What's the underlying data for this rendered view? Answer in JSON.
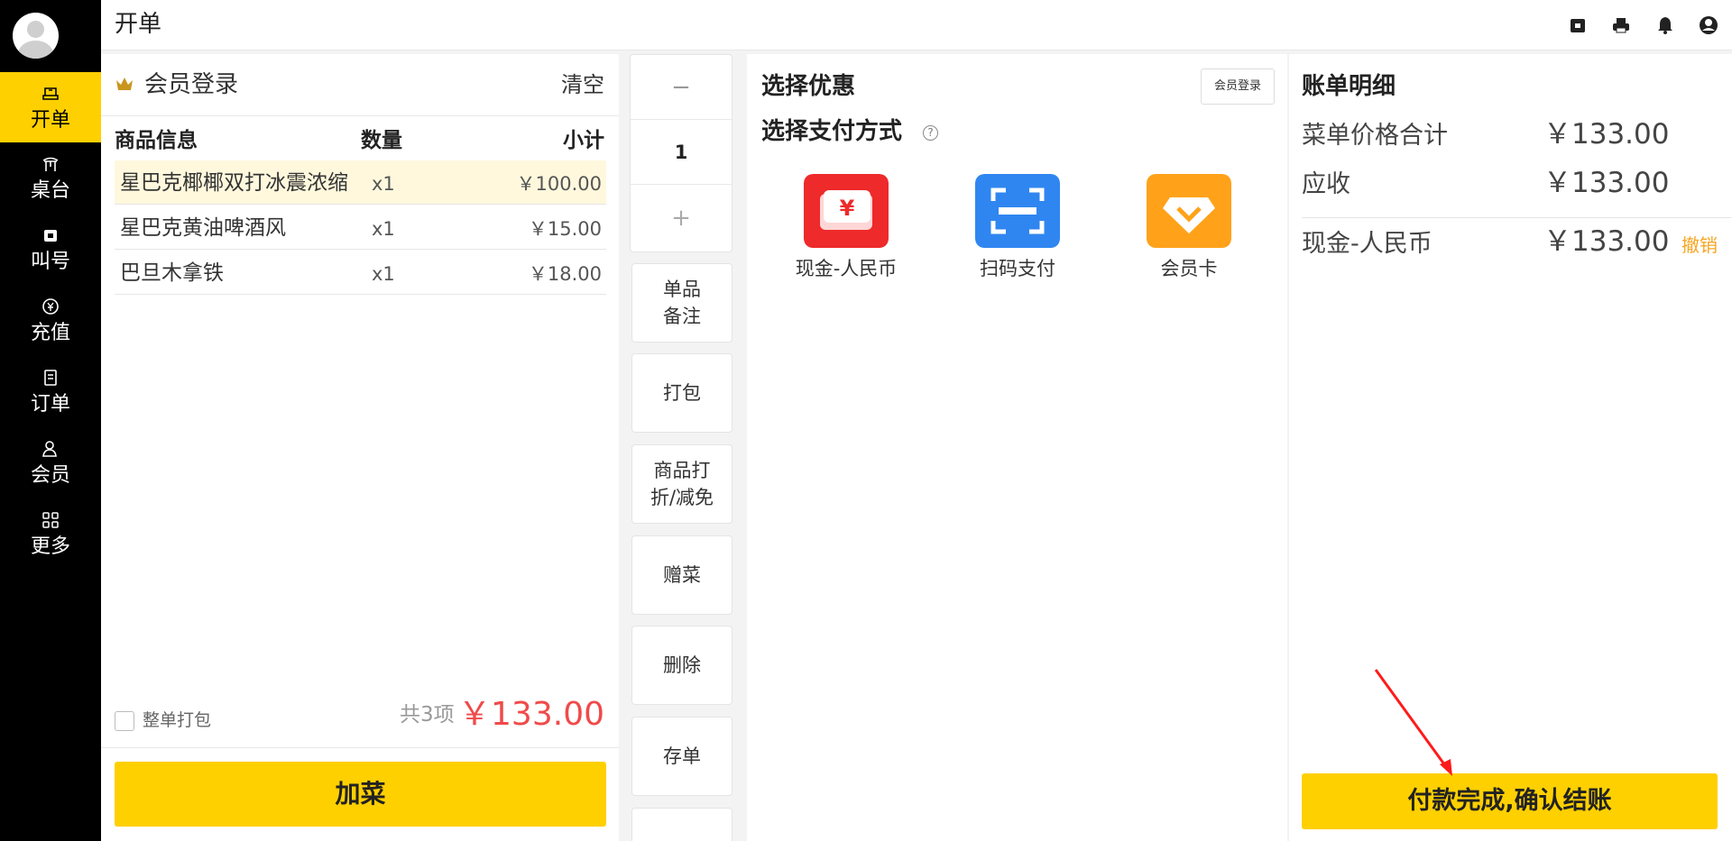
{
  "header": {
    "title": "开单"
  },
  "sidebar": {
    "items": [
      {
        "label": "开单",
        "icon": "cashier-icon",
        "active": true
      },
      {
        "label": "桌台",
        "icon": "table-icon",
        "active": false
      },
      {
        "label": "叫号",
        "icon": "call-number-icon",
        "active": false
      },
      {
        "label": "充值",
        "icon": "recharge-icon",
        "active": false
      },
      {
        "label": "订单",
        "icon": "orders-icon",
        "active": false
      },
      {
        "label": "会员",
        "icon": "member-icon",
        "active": false
      },
      {
        "label": "更多",
        "icon": "more-icon",
        "active": false
      }
    ]
  },
  "top_icons": [
    "cash-drawer-icon",
    "printer-icon",
    "bell-icon",
    "user-account-icon"
  ],
  "order": {
    "member_login": "会员登录",
    "clear": "清空",
    "columns": {
      "info": "商品信息",
      "qty": "数量",
      "subtotal": "小计"
    },
    "items": [
      {
        "name": "星巴克椰椰双打冰震浓缩",
        "qty": "x1",
        "price": "￥100.00",
        "selected": true
      },
      {
        "name": "星巴克黄油啤酒风",
        "qty": "x1",
        "price": "￥15.00",
        "selected": false
      },
      {
        "name": "巴旦木拿铁",
        "qty": "x1",
        "price": "￥18.00",
        "selected": false
      }
    ],
    "whole_pack_label": "整单打包",
    "item_count": "共3项",
    "total": "￥133.00",
    "add_dish": "加菜"
  },
  "actions": {
    "minus": "−",
    "quantity": "1",
    "plus": "+",
    "item_note": "单品\n备注",
    "pack": "打包",
    "discount": "商品打\n折/减免",
    "gift": "赠菜",
    "delete": "删除",
    "save_order": "存单"
  },
  "payment": {
    "discount_title": "选择优惠",
    "member_login": "会员登录",
    "method_title": "选择支付方式",
    "help": "?",
    "methods": [
      {
        "label": "现金-人民币",
        "icon": "cash-icon",
        "color": "#ee2a2a"
      },
      {
        "label": "扫码支付",
        "icon": "scan-pay-icon",
        "color": "#2f86f0"
      },
      {
        "label": "会员卡",
        "icon": "member-card-icon",
        "color": "#ffa21a"
      }
    ]
  },
  "bill": {
    "title": "账单明细",
    "menu_total_label": "菜单价格合计",
    "menu_total_value": "￥133.00",
    "receivable_label": "应收",
    "receivable_value": "￥133.00",
    "cash_label": "现金-人民币",
    "cash_value": "￥133.00",
    "cancel": "撤销",
    "confirm": "付款完成,确认结账"
  },
  "colors": {
    "accent": "#ffd000",
    "total_red": "#f04a4a",
    "cancel_orange": "#f5a623",
    "sidebar_bg": "#000000"
  }
}
